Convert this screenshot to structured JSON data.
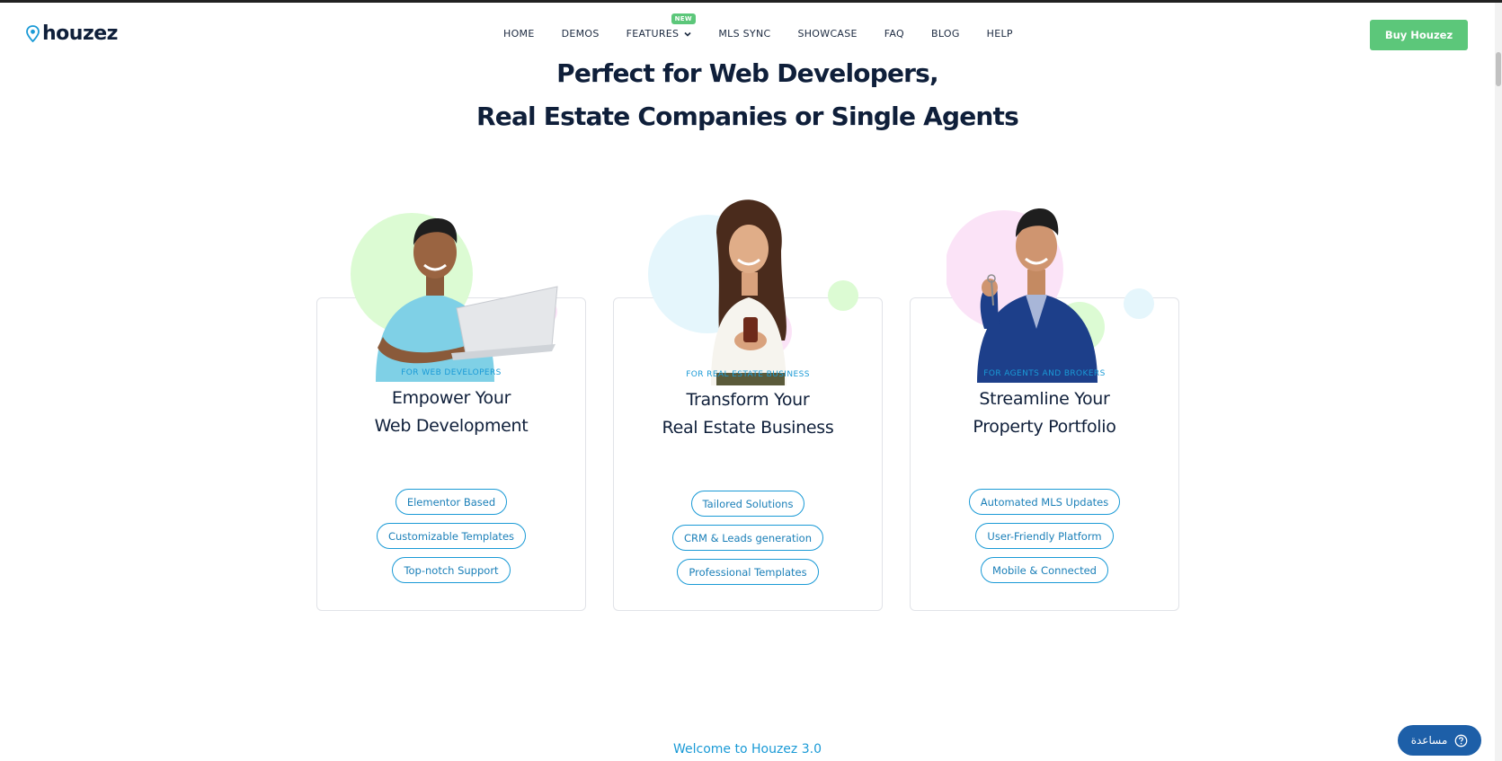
{
  "brand": {
    "logo_text": "houzez",
    "accent_green": "#5cc77a",
    "accent_blue": "#1a9ad6",
    "text_dark": "#0f1f3a"
  },
  "nav": {
    "items": [
      {
        "label": "HOME"
      },
      {
        "label": "DEMOS"
      },
      {
        "label": "FEATURES",
        "badge": "NEW",
        "icon": "chevron-down-icon"
      },
      {
        "label": "MLS SYNC"
      },
      {
        "label": "SHOWCASE"
      },
      {
        "label": "FAQ"
      },
      {
        "label": "BLOG"
      },
      {
        "label": "HELP"
      }
    ],
    "cta_label": "Buy Houzez"
  },
  "hero": {
    "line1": "Perfect for Web Developers,",
    "line2": "Real Estate Companies or Single Agents"
  },
  "cards": [
    {
      "eyebrow": "FOR WEB DEVELOPERS",
      "title_line1": "Empower Your",
      "title_line2": "Web Development",
      "illustration": "developer-with-laptop",
      "pills": [
        "Elementor Based",
        "Customizable Templates",
        "Top-notch Support"
      ]
    },
    {
      "eyebrow": "FOR REAL ESTATE BUSINESS",
      "title_line1": "Transform Your",
      "title_line2": "Real Estate Business",
      "illustration": "businesswoman-with-phone",
      "pills": [
        "Tailored Solutions",
        "CRM & Leads generation",
        "Professional Templates"
      ]
    },
    {
      "eyebrow": "FOR AGENTS AND BROKERS",
      "title_line1": "Streamline Your",
      "title_line2": "Property Portfolio",
      "illustration": "agent-holding-keys",
      "pills": [
        "Automated MLS Updates",
        "User-Friendly Platform",
        "Mobile & Connected"
      ]
    }
  ],
  "welcome_text": "Welcome to Houzez 3.0",
  "help_widget": {
    "label": "مساعدة",
    "icon": "help-circle-icon"
  }
}
